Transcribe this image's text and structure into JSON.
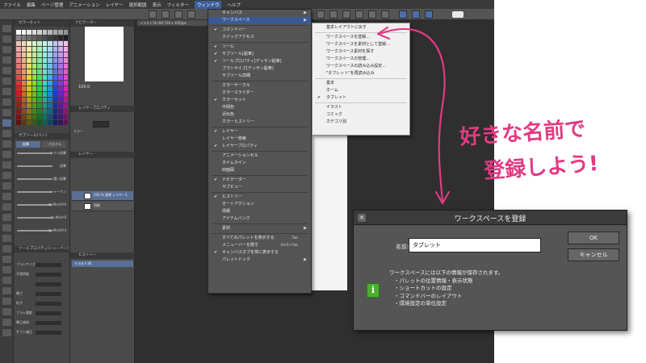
{
  "menubar": {
    "items": [
      "ファイル",
      "編集",
      "ページ管理",
      "アニメーション",
      "レイヤー",
      "選択範囲",
      "表示",
      "フィルター",
      "ウィンドウ",
      "ヘルプ"
    ],
    "active": "ウィンドウ"
  },
  "panels": {
    "color_title": "カラーセット",
    "navigator_title": "ナビゲーター",
    "navigator_zoom": "100.0",
    "subtool_title": "サブツール[ペン]",
    "subtool_tabs": [
      "鉛筆",
      "パステル"
    ],
    "brushes": [
      "リアル鉛筆",
      "鉛筆",
      "濃い鉛筆",
      "シャーペン",
      "dp-MechP.6",
      "dp-MechP",
      "dp-MechP.4"
    ],
    "toolprop_title": "ツールプロパティ[シャーペン]",
    "toolprop_rows": [
      "ブラシサイズ",
      "不透明度",
      "",
      "硬さ",
      "粒子",
      "ブラシ濃度",
      "筆圧感知",
      "手ブレ補正"
    ],
    "layerprop_title": "レイヤープロパティ",
    "layerprop_label": "カラー",
    "layer_title": "レイヤー",
    "layers": [
      {
        "name": "100 % 通常 レイヤー1",
        "selected": true
      },
      {
        "name": "用紙",
        "selected": false
      }
    ],
    "history_title": "ヒストリー",
    "history_item": "イラスト16"
  },
  "doc_tab": "イラスト16 (94:729 x 1052px",
  "window_menu": {
    "items": [
      {
        "label": "キャンバス",
        "check": false,
        "arrow": true,
        "shortcut": ""
      },
      {
        "label": "ワークスペース",
        "check": false,
        "arrow": true,
        "shortcut": "",
        "highlight": true
      },
      {
        "sep": true
      },
      {
        "label": "コマンドバー",
        "check": true
      },
      {
        "label": "クイックアクセス",
        "check": false
      },
      {
        "sep": true
      },
      {
        "label": "ツール",
        "check": true
      },
      {
        "label": "サブツール[鉛筆]",
        "check": true
      },
      {
        "label": "ツールプロパティ[デッサン鉛筆]",
        "check": true
      },
      {
        "label": "ブラシサイズ[デッサン鉛筆]",
        "check": false
      },
      {
        "label": "サブツール詳細",
        "check": false
      },
      {
        "sep": true
      },
      {
        "label": "カラーサークル",
        "check": false
      },
      {
        "label": "カラースライダー",
        "check": false
      },
      {
        "label": "カラーセット",
        "check": true
      },
      {
        "label": "中間色",
        "check": false
      },
      {
        "label": "近似色",
        "check": false
      },
      {
        "label": "カラーヒストリー",
        "check": false
      },
      {
        "sep": true
      },
      {
        "label": "レイヤー",
        "check": true
      },
      {
        "label": "レイヤー検索",
        "check": false
      },
      {
        "label": "レイヤープロパティ",
        "check": true
      },
      {
        "sep": true
      },
      {
        "label": "アニメーションセル",
        "check": false
      },
      {
        "label": "タイムライン",
        "check": false
      },
      {
        "label": "四面図",
        "check": false
      },
      {
        "sep": true
      },
      {
        "label": "ナビゲーター",
        "check": true
      },
      {
        "label": "サブビュー",
        "check": false
      },
      {
        "sep": true
      },
      {
        "label": "ヒストリー",
        "check": true
      },
      {
        "label": "オートアクション",
        "check": false
      },
      {
        "label": "情報",
        "check": false
      },
      {
        "label": "アイテムバンク",
        "check": false
      },
      {
        "sep": true
      },
      {
        "label": "素材",
        "check": false,
        "arrow": true
      },
      {
        "sep": true
      },
      {
        "label": "すべてのパレットを表示する",
        "check": false,
        "shortcut": "Tab"
      },
      {
        "label": "メニューバーを隠す",
        "check": false,
        "shortcut": "Shift+Tab"
      },
      {
        "label": "キャンバスタブを常に表示する",
        "check": true
      },
      {
        "label": "パレットドック",
        "check": false,
        "arrow": true
      }
    ]
  },
  "workspace_menu": {
    "items": [
      {
        "label": "基本レイアウトに戻す",
        "check": false
      },
      {
        "sep": true
      },
      {
        "label": "ワークスペースを登録...",
        "check": false
      },
      {
        "label": "ワークスペースを素材として登録...",
        "check": false
      },
      {
        "label": "ワークスペース素材を探す",
        "check": false
      },
      {
        "label": "ワークスペースの管理...",
        "check": false
      },
      {
        "label": "ワークスペースの読み込み設定...",
        "check": false
      },
      {
        "label": "\"タブレット\"を再読み込み",
        "check": false
      },
      {
        "sep": true
      },
      {
        "label": "基本",
        "check": false
      },
      {
        "label": "ホーム",
        "check": false
      },
      {
        "label": "タブレット",
        "check": true
      },
      {
        "sep": true
      },
      {
        "label": "イラスト",
        "check": false
      },
      {
        "label": "コミック",
        "check": false
      },
      {
        "label": "カテゴリ別",
        "check": false
      }
    ]
  },
  "dialog": {
    "title": "ワークスペースを登録",
    "close_glyph": "✕",
    "name_label": "名前:",
    "name_value": "タブレット",
    "ok_label": "OK",
    "cancel_label": "キャンセル",
    "info_glyph": "i",
    "info_lines": [
      "ワークスペースには以下の情報が保存されます。",
      "・パレットの位置情報・表示状態",
      "・ショートカットの設定",
      "・コマンドバーのレイアウト",
      "・環境設定の単位設定"
    ]
  },
  "annotation": {
    "line1": "好きな名前で",
    "line2": "登録しよう!",
    "color": "#e23a82"
  },
  "colors": {
    "menu_highlight": "#3a5a94",
    "ok_icon": "#4caf2f"
  }
}
